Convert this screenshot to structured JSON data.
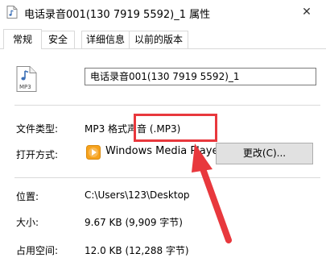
{
  "window": {
    "title": "电话录音001(130 7919 5592)_1 属性",
    "close_glyph": "✕"
  },
  "tabs": [
    {
      "label": "常规",
      "active": true
    },
    {
      "label": "安全",
      "active": false
    },
    {
      "label": "详细信息",
      "active": false
    },
    {
      "label": "以前的版本",
      "active": false
    }
  ],
  "file": {
    "icon_text": "MP3",
    "name": "电话录音001(130 7919 5592)_1"
  },
  "properties": {
    "type_label": "文件类型:",
    "type_value": "MP3 格式声音 (.MP3)",
    "opens_label": "打开方式:",
    "opens_app": "Windows Media Player",
    "change_button": "更改(C)...",
    "location_label": "位置:",
    "location_value": "C:\\Users\\123\\Desktop",
    "size_label": "大小:",
    "size_value": "9.67 KB (9,909 字节)",
    "disk_label": "占用空间:",
    "disk_value": "12.0 KB (12,288 字节)"
  },
  "colors": {
    "annotation": "#e8383d",
    "app_icon": "#f7a21b"
  }
}
